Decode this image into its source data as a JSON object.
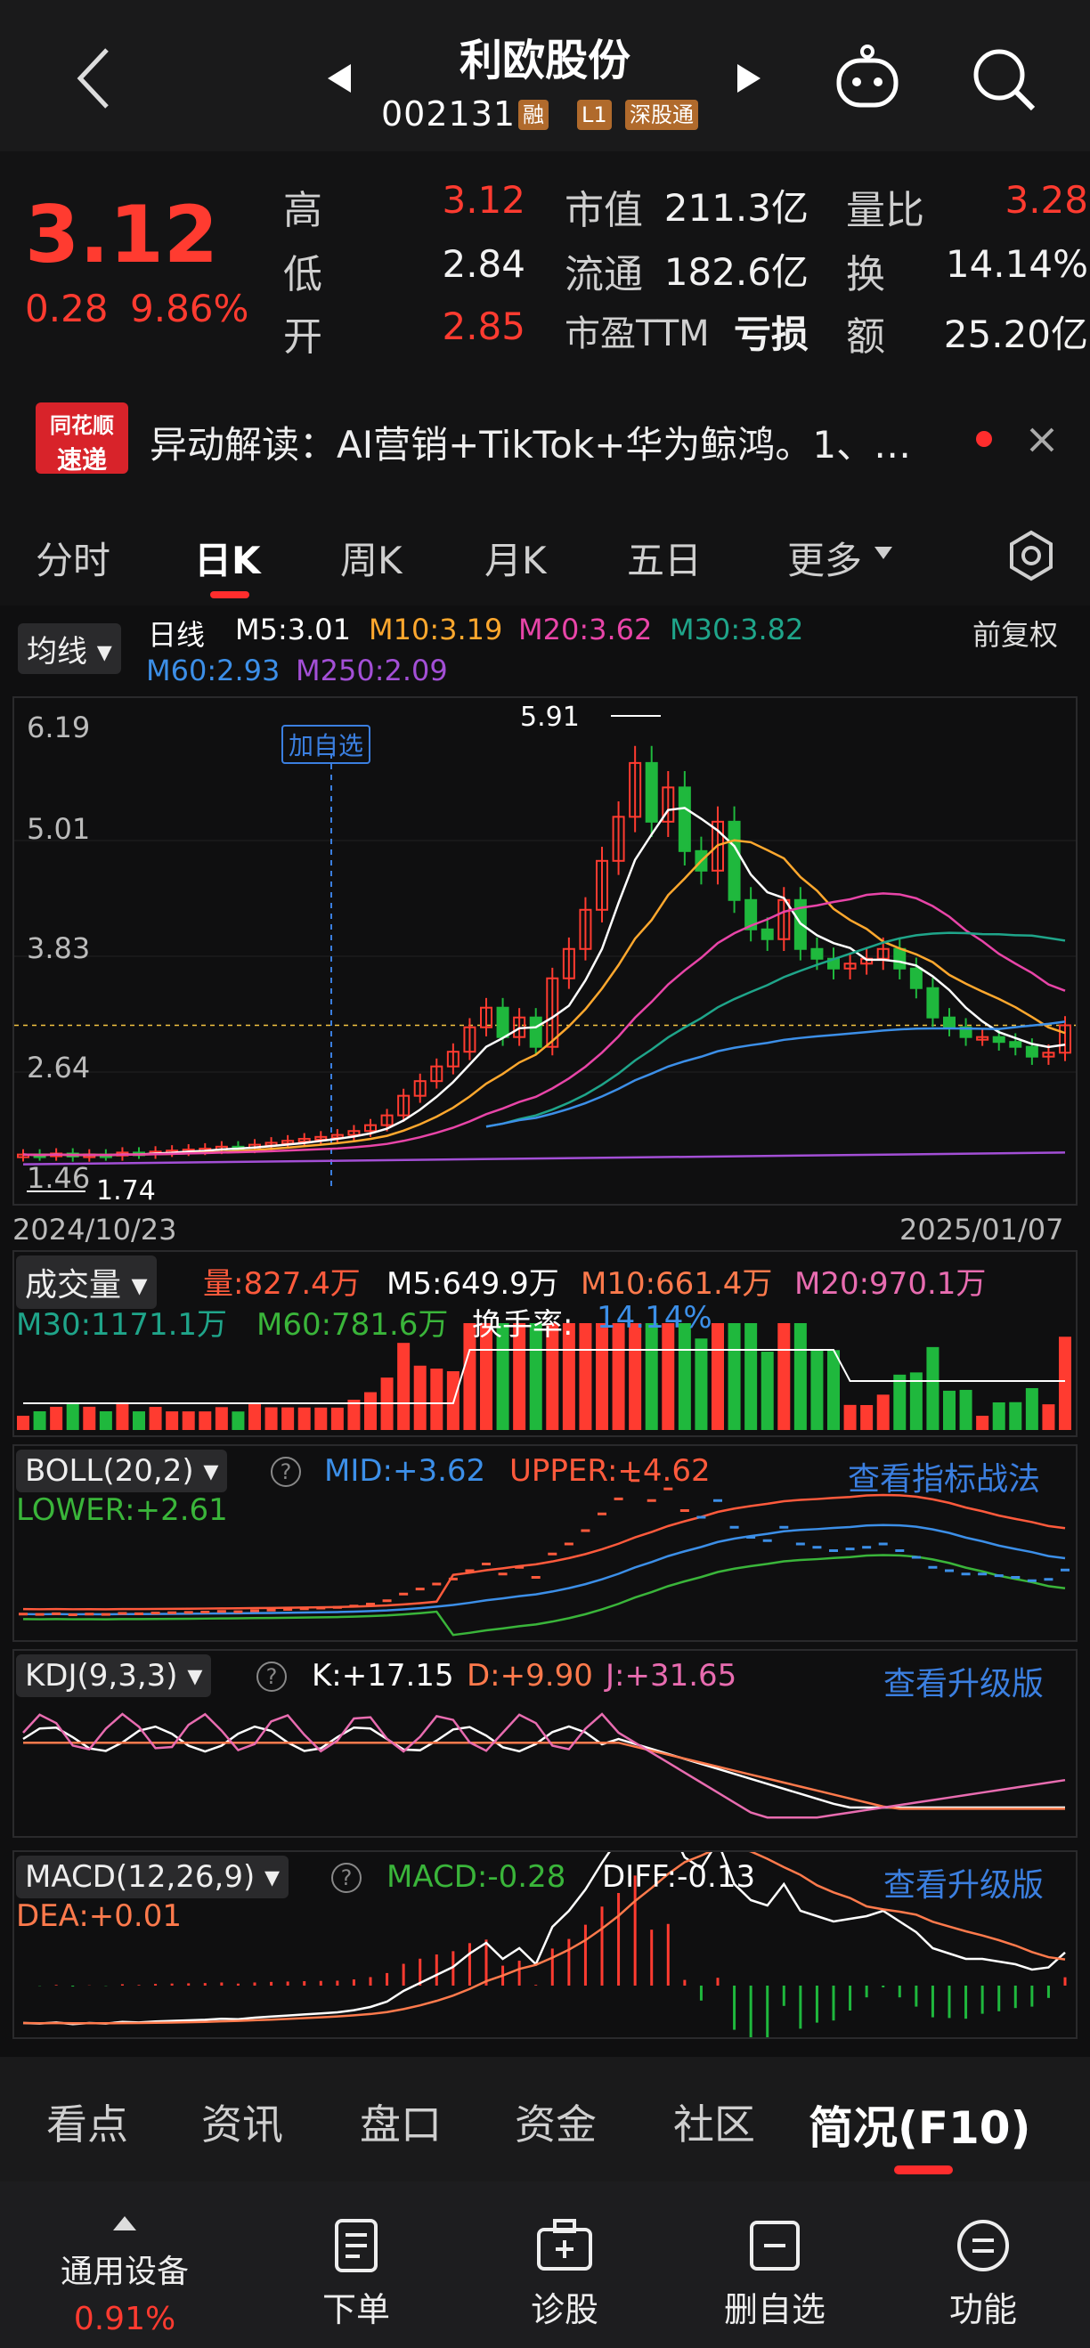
{
  "header": {
    "back_icon": "chevron-left-icon",
    "stock_name": "利欧股份",
    "stock_code": "002131",
    "tags": [
      "融",
      "L1",
      "深股通"
    ],
    "prev_icon": "triangle-left-icon",
    "next_icon": "triangle-right-icon",
    "robot_icon": "robot-icon",
    "search_icon": "search-icon"
  },
  "quote": {
    "price": "3.12",
    "change": "0.28",
    "change_pct": "9.86%",
    "rows": [
      {
        "k1": "高",
        "v1": "3.12",
        "k2": "市值",
        "v2": "211.3亿",
        "k3": "量比",
        "v3": "3.28"
      },
      {
        "k1": "低",
        "v1": "2.84",
        "k2": "流通",
        "v2": "182.6亿",
        "k3": "换",
        "v3": "14.14%"
      },
      {
        "k1": "开",
        "v1": "2.85",
        "k2": "市盈TTM",
        "v2": "亏损",
        "k3": "额",
        "v3": "25.20亿"
      }
    ]
  },
  "news": {
    "logo_top": "同花顺",
    "logo_bottom": "速递",
    "text": "异动解读：AI营销+TikTok+华为鲸鸿。1、…",
    "close_icon": "close-icon"
  },
  "period_tabs": [
    "分时",
    "日K",
    "周K",
    "月K",
    "五日",
    "更多"
  ],
  "active_period": "日K",
  "settings_icon": "gear-icon",
  "kline": {
    "ma_button": "均线",
    "line_type": "日线",
    "ma": [
      {
        "label": "M5:3.01",
        "color": "#ffffff"
      },
      {
        "label": "M10:3.19",
        "color": "#ffa82e"
      },
      {
        "label": "M20:3.62",
        "color": "#e845a8"
      },
      {
        "label": "M30:3.82",
        "color": "#1fa58a"
      },
      {
        "label": "M60:2.93",
        "color": "#3c8fe8"
      },
      {
        "label": "M250:2.09",
        "color": "#a34fd6"
      }
    ],
    "adjust": "前复权",
    "y_ticks": [
      "6.19",
      "5.01",
      "3.83",
      "2.64",
      "1.46"
    ],
    "max_label": "5.91",
    "min_label": "1.74",
    "add_watch": "加自选",
    "date_start": "2024/10/23",
    "date_end": "2025/01/07"
  },
  "chart_data": [
    {
      "type": "candlestick",
      "title": "日线",
      "x_range": [
        "2024/10/23",
        "2025/01/07"
      ],
      "ylim": [
        1.46,
        6.19
      ],
      "close": [
        1.8,
        1.79,
        1.81,
        1.78,
        1.8,
        1.79,
        1.82,
        1.81,
        1.83,
        1.84,
        1.85,
        1.86,
        1.88,
        1.87,
        1.9,
        1.92,
        1.94,
        1.96,
        1.98,
        2.0,
        2.04,
        2.1,
        2.2,
        2.4,
        2.55,
        2.7,
        2.85,
        3.1,
        3.3,
        3.0,
        3.2,
        2.9,
        3.6,
        3.9,
        4.3,
        4.8,
        5.25,
        5.8,
        5.2,
        5.55,
        4.9,
        4.7,
        5.2,
        4.4,
        4.1,
        4.0,
        4.4,
        3.9,
        3.8,
        3.7,
        3.75,
        3.8,
        3.9,
        3.7,
        3.5,
        3.2,
        3.1,
        3.0,
        3.0,
        2.95,
        2.9,
        2.8,
        2.84,
        3.12
      ],
      "markers": {
        "high_label": 5.91,
        "low_label": 1.74
      }
    },
    {
      "type": "bar",
      "title": "成交量",
      "series_labels": [
        "量:827.4万",
        "M5:649.9万",
        "M10:661.4万",
        "M20:970.1万",
        "M30:1171.1万",
        "M60:781.6万"
      ],
      "turnover": "14.14%"
    },
    {
      "type": "line",
      "title": "BOLL(20,2)",
      "values": {
        "MID": "+3.62",
        "UPPER": "+4.62",
        "LOWER": "+2.61"
      }
    },
    {
      "type": "line",
      "title": "KDJ(9,3,3)",
      "values": {
        "K": "+17.15",
        "D": "+9.90",
        "J": "+31.65"
      }
    },
    {
      "type": "bar",
      "title": "MACD(12,26,9)",
      "values": {
        "MACD": "-0.28",
        "DIFF": "-0.13",
        "DEA": "+0.01"
      }
    }
  ],
  "volume": {
    "button": "成交量",
    "items": [
      {
        "label": "量:827.4万",
        "color": "#ff5a3c"
      },
      {
        "label": "M5:649.9万",
        "color": "#ffffff"
      },
      {
        "label": "M10:661.4万",
        "color": "#ff7a4c"
      },
      {
        "label": "M20:970.1万",
        "color": "#e86cb0"
      },
      {
        "label": "M30:1171.1万",
        "color": "#1fa58a"
      },
      {
        "label": "M60:781.6万",
        "color": "#3ab53a"
      }
    ],
    "turnover_label": "换手率:",
    "turnover_value": "14.14%"
  },
  "boll": {
    "button": "BOLL(20,2)",
    "mid": "MID:+3.62",
    "upper": "UPPER:+4.62",
    "lower": "LOWER:+2.61",
    "link": "查看指标战法"
  },
  "kdj": {
    "button": "KDJ(9,3,3)",
    "k": "K:+17.15",
    "d": "D:+9.90",
    "j": "J:+31.65",
    "link": "查看升级版"
  },
  "macd": {
    "button": "MACD(12,26,9)",
    "macd": "MACD:-0.28",
    "diff": "DIFF:-0.13",
    "dea": "DEA:+0.01",
    "link": "查看升级版"
  },
  "bottom_tabs": [
    "看点",
    "资讯",
    "盘口",
    "资金",
    "社区",
    "简况(F10)"
  ],
  "active_bottom_tab": "简况(F10)",
  "toolbar": [
    {
      "label": "通用设备",
      "sub": "0.91%",
      "icon": "triangle-up-icon"
    },
    {
      "label": "下单",
      "icon": "document-icon"
    },
    {
      "label": "诊股",
      "icon": "medical-kit-icon"
    },
    {
      "label": "删自选",
      "icon": "minus-box-icon"
    },
    {
      "label": "功能",
      "icon": "menu-circle-icon"
    }
  ],
  "colors": {
    "up": "#ff3b30",
    "down": "#1fb83d",
    "accent": "#ff2d2d",
    "link": "#3b7fe0"
  }
}
